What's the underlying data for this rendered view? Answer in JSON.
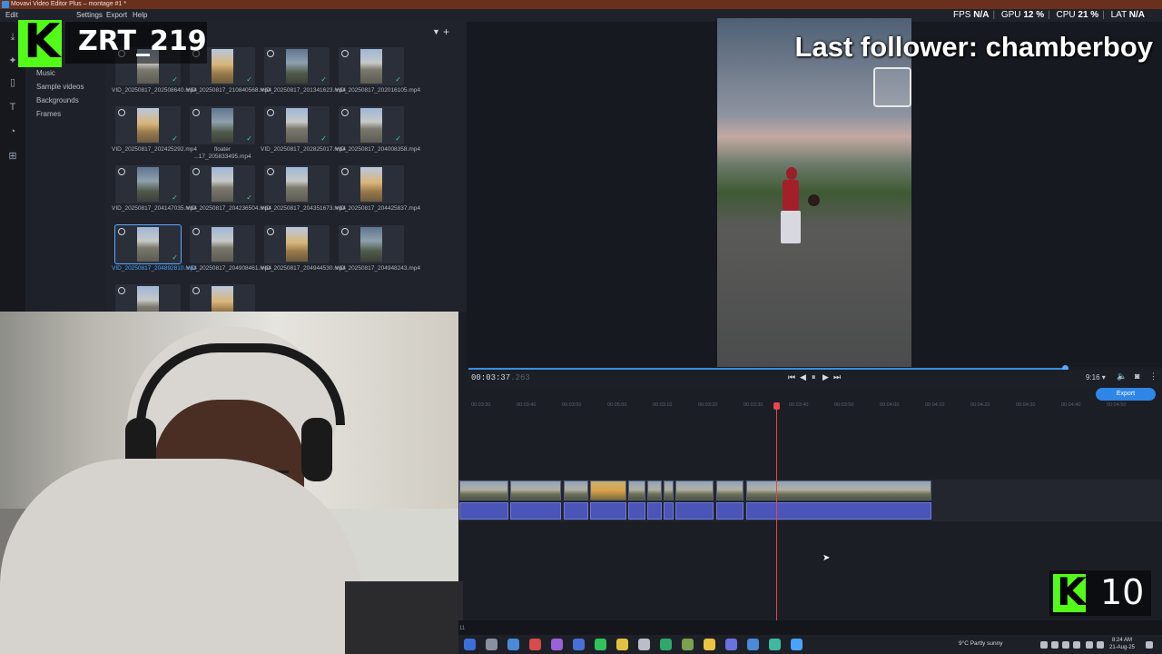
{
  "app": {
    "title": "Movavi Video Editor Plus – montage #1 *",
    "menu": [
      "Edit",
      "Settings",
      "Export",
      "Help"
    ]
  },
  "nav": {
    "items": [
      "Music",
      "Sample videos",
      "Backgrounds",
      "Frames"
    ]
  },
  "media": {
    "files": [
      {
        "label": "VID_20250817_202508640.mp4",
        "checked": true,
        "selected": false
      },
      {
        "label": "VID_20250817_210840568.mp4",
        "checked": true,
        "selected": false
      },
      {
        "label": "VID_20250817_201341623.mp4",
        "checked": true,
        "selected": false
      },
      {
        "label": "VID_20250817_202016105.mp4",
        "checked": true,
        "selected": false
      },
      {
        "label": "VID_20250817_202425292.mp4",
        "checked": true,
        "selected": false
      },
      {
        "label": "floater ...17_205833495.mp4",
        "checked": true,
        "selected": false
      },
      {
        "label": "VID_20250817_202825017.mp4",
        "checked": true,
        "selected": false
      },
      {
        "label": "VID_20250817_204008358.mp4",
        "checked": true,
        "selected": false
      },
      {
        "label": "VID_20250817_204147035.mp4",
        "checked": true,
        "selected": false
      },
      {
        "label": "VID_20250817_204236504.mp4",
        "checked": true,
        "selected": false
      },
      {
        "label": "VID_20250817_204351673.mp4",
        "checked": false,
        "selected": false
      },
      {
        "label": "VID_20250817_204425837.mp4",
        "checked": false,
        "selected": false
      },
      {
        "label": "VID_20250817_204892810.mp4",
        "checked": true,
        "selected": true
      },
      {
        "label": "VID_20250817_204908461.mp4",
        "checked": false,
        "selected": false
      },
      {
        "label": "VID_20250817_204944530.mp4",
        "checked": false,
        "selected": false
      },
      {
        "label": "VID_20250817_204948243.mp4",
        "checked": false,
        "selected": false
      },
      {
        "label": "",
        "checked": false,
        "selected": false
      },
      {
        "label": "",
        "checked": false,
        "selected": false
      }
    ]
  },
  "preview": {
    "overlay_text": "Last follower: chamberboy",
    "timecode": "00:03:37",
    "timecode_frames": ".263",
    "aspect_ratio": "9:16 ▾",
    "export_label": "Export",
    "progress": 1.0
  },
  "timeline": {
    "ticks": [
      "00:03:30",
      "00:03:40",
      "00:03:50",
      "00:05:00",
      "00:03:10",
      "00:03:20",
      "00:03:30",
      "00:03:40",
      "00:03:50",
      "00:04:00",
      "00:04:10",
      "00:04:20",
      "00:04:30",
      "00:04:40",
      "00:04:50"
    ],
    "status_number": "11"
  },
  "stream": {
    "streamer": "ZRT_219",
    "kick_logo": "K",
    "follower_count": "10"
  },
  "stats": {
    "fps_label": "FPS",
    "fps_value": "N/A",
    "gpu_label": "GPU",
    "gpu_value": "12 %",
    "cpu_label": "CPU",
    "cpu_value": "21 %",
    "lat_label": "LAT",
    "lat_value": "N/A"
  },
  "taskbar": {
    "weather": "9°C  Partly sunny",
    "time": "8:24 AM",
    "date": "21-Aug-25"
  },
  "colors": {
    "accent": "#2f86e6",
    "playhead": "#e8454f",
    "kick": "#53fc18",
    "check": "#3fd18f"
  }
}
